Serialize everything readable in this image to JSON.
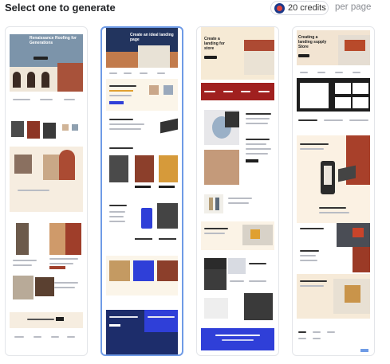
{
  "header": {
    "title": "Select one to generate",
    "credits_label": "20 credits",
    "per_page_label": "per page",
    "credits_icon": "coin-icon"
  },
  "templates": [
    {
      "hero_text": "Renaissance Roofing for Generations",
      "accent": "#b75f3c",
      "hero": "#6f8aa3",
      "selected": false
    },
    {
      "hero_text": "Create an ideal landing page",
      "accent": "#2f3fd8",
      "hero": "#1f2f55",
      "selected": true
    },
    {
      "hero_text": "Create a landing for store",
      "accent": "#a0201f",
      "hero": "#f3e7d2",
      "selected": false
    },
    {
      "hero_text": "Creating a landing supply Store",
      "accent": "#b84a2a",
      "hero": "#e9d8c4",
      "selected": false
    }
  ],
  "colors": {
    "cream": "#f7efe0",
    "dark": "#1e1e1e",
    "brick": "#9d3a2a",
    "navy": "#1d2d6b",
    "blue": "#2f3fd8"
  }
}
